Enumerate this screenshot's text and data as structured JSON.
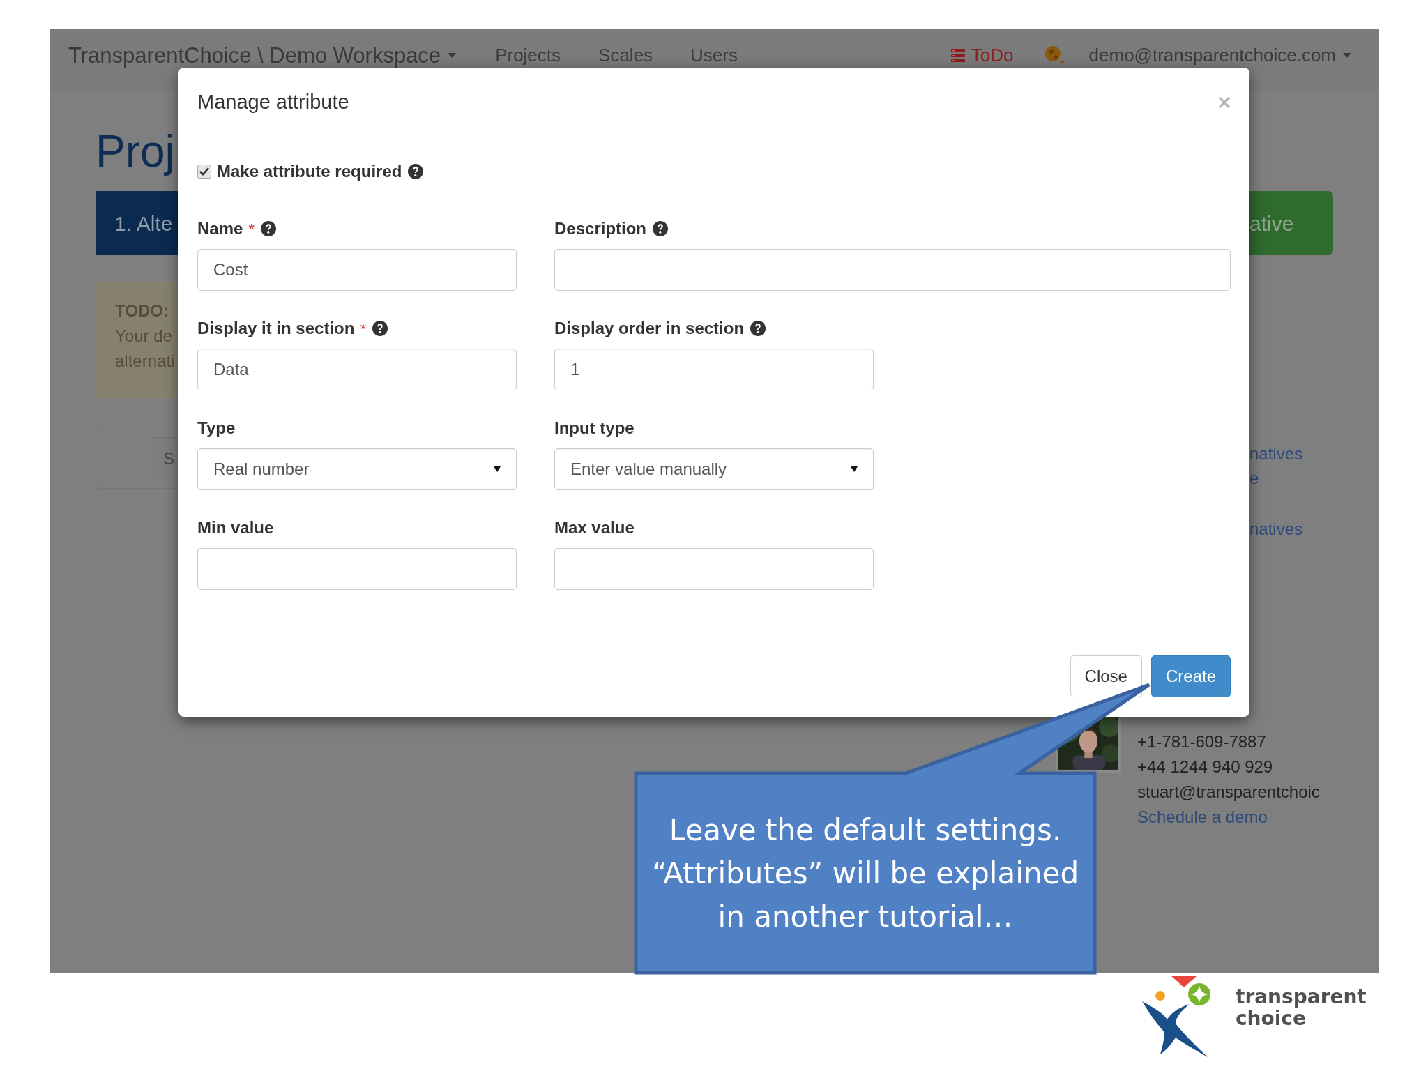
{
  "navbar": {
    "brand": "TransparentChoice \\ Demo Workspace",
    "links": [
      {
        "label": "Projects"
      },
      {
        "label": "Scales"
      },
      {
        "label": "Users"
      }
    ],
    "todo": "ToDo",
    "user": "demo@transparentchoice.com"
  },
  "page": {
    "title": "Proj",
    "step_tab": "1. Alte",
    "action_button": "ative",
    "todo_box": {
      "heading": "TODO:",
      "lines": [
        "Your de",
        "alternati"
      ]
    },
    "panel_button": "S",
    "side_links": [
      "natives",
      "e",
      "natives"
    ],
    "contact": {
      "lines": [
        "+1-781-609-7887",
        "+44 1244 940 929",
        "stuart@transparentchoic"
      ],
      "link": "Schedule a demo"
    }
  },
  "modal": {
    "title": "Manage attribute",
    "required_option": {
      "label": "Make attribute required",
      "checked": true
    },
    "fields": [
      {
        "label": "Name",
        "required_mark": "*",
        "help": true,
        "kind": "text",
        "value": "Cost"
      },
      {
        "label": "Description",
        "help": true,
        "kind": "text",
        "wide": true
      },
      {
        "label": "Display it in section",
        "required_mark": "*",
        "help": true,
        "kind": "text",
        "value": "Data"
      },
      {
        "label": "Display order in section",
        "help": true,
        "kind": "text",
        "value": "1"
      },
      {
        "label": "Type",
        "kind": "select",
        "value": "Real number"
      },
      {
        "label": "Input type",
        "kind": "select",
        "value": "Enter value manually"
      },
      {
        "label": "Min value",
        "kind": "text"
      },
      {
        "label": "Max value",
        "kind": "text"
      }
    ],
    "buttons": [
      {
        "label": "Close",
        "kind": "default"
      },
      {
        "label": "Create",
        "kind": "primary"
      }
    ]
  },
  "callout": {
    "lines": [
      "Leave the default settings.",
      "“Attributes” will be explained",
      "in another tutorial…"
    ]
  },
  "logo": {
    "lines": [
      "transparent",
      "choice"
    ]
  }
}
